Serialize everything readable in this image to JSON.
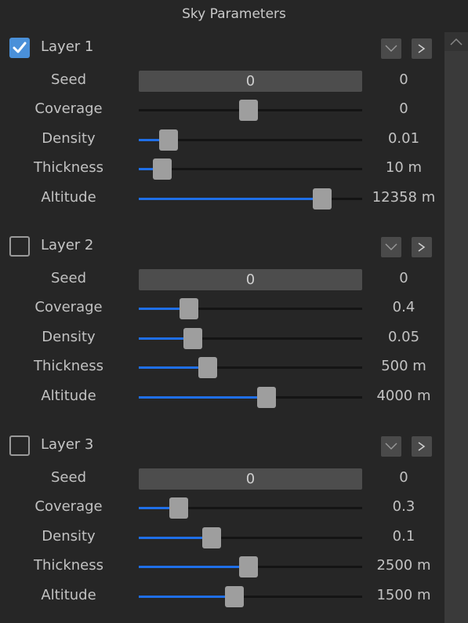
{
  "panel": {
    "title": "Sky Parameters"
  },
  "scrollbar": {
    "up_icon": "chevron-up-icon"
  },
  "layers": [
    {
      "label": "Layer 1",
      "enabled": true,
      "expand_icon": "chevron-down-icon",
      "next_icon": "chevron-right-icon",
      "seed": {
        "label": "Seed",
        "field_value": "0",
        "value": "0"
      },
      "sliders": [
        {
          "label": "Coverage",
          "value": "0",
          "position": 0.49
        },
        {
          "label": "Density",
          "value": "0.01",
          "position": 0.1
        },
        {
          "label": "Thickness",
          "value": "10 m",
          "position": 0.07
        },
        {
          "label": "Altitude",
          "value": "12358 m",
          "position": 0.85
        }
      ]
    },
    {
      "label": "Layer 2",
      "enabled": false,
      "expand_icon": "chevron-down-icon",
      "next_icon": "chevron-right-icon",
      "seed": {
        "label": "Seed",
        "field_value": "0",
        "value": "0"
      },
      "sliders": [
        {
          "label": "Coverage",
          "value": "0.4",
          "position": 0.2
        },
        {
          "label": "Density",
          "value": "0.05",
          "position": 0.22
        },
        {
          "label": "Thickness",
          "value": "500 m",
          "position": 0.29
        },
        {
          "label": "Altitude",
          "value": "4000 m",
          "position": 0.58
        }
      ]
    },
    {
      "label": "Layer 3",
      "enabled": false,
      "expand_icon": "chevron-down-icon",
      "next_icon": "chevron-right-icon",
      "seed": {
        "label": "Seed",
        "field_value": "0",
        "value": "0"
      },
      "sliders": [
        {
          "label": "Coverage",
          "value": "0.3",
          "position": 0.15
        },
        {
          "label": "Density",
          "value": "0.1",
          "position": 0.31
        },
        {
          "label": "Thickness",
          "value": "2500 m",
          "position": 0.49
        },
        {
          "label": "Altitude",
          "value": "1500 m",
          "position": 0.42
        }
      ]
    }
  ],
  "colors": {
    "accent": "#1f6fe8",
    "checkbox_checked": "#4a90d9",
    "background": "#262626"
  }
}
